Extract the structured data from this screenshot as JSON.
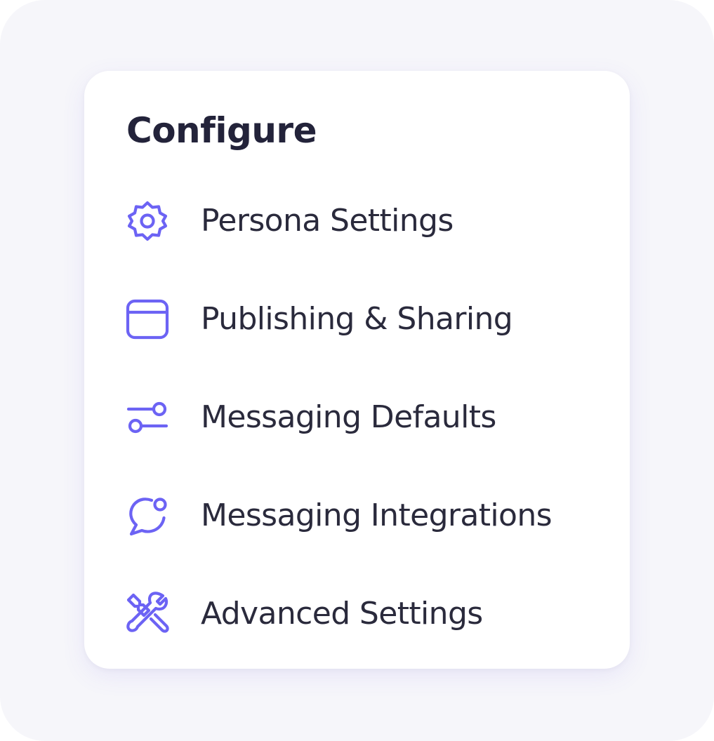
{
  "panel": {
    "title": "Configure",
    "accent_color": "#6c63f4",
    "items": [
      {
        "label": "Persona Settings",
        "icon": "gear-icon"
      },
      {
        "label": "Publishing & Sharing",
        "icon": "browser-window-icon"
      },
      {
        "label": "Messaging Defaults",
        "icon": "sliders-icon"
      },
      {
        "label": "Messaging Integrations",
        "icon": "chat-notification-icon"
      },
      {
        "label": "Advanced Settings",
        "icon": "tools-icon"
      }
    ]
  }
}
